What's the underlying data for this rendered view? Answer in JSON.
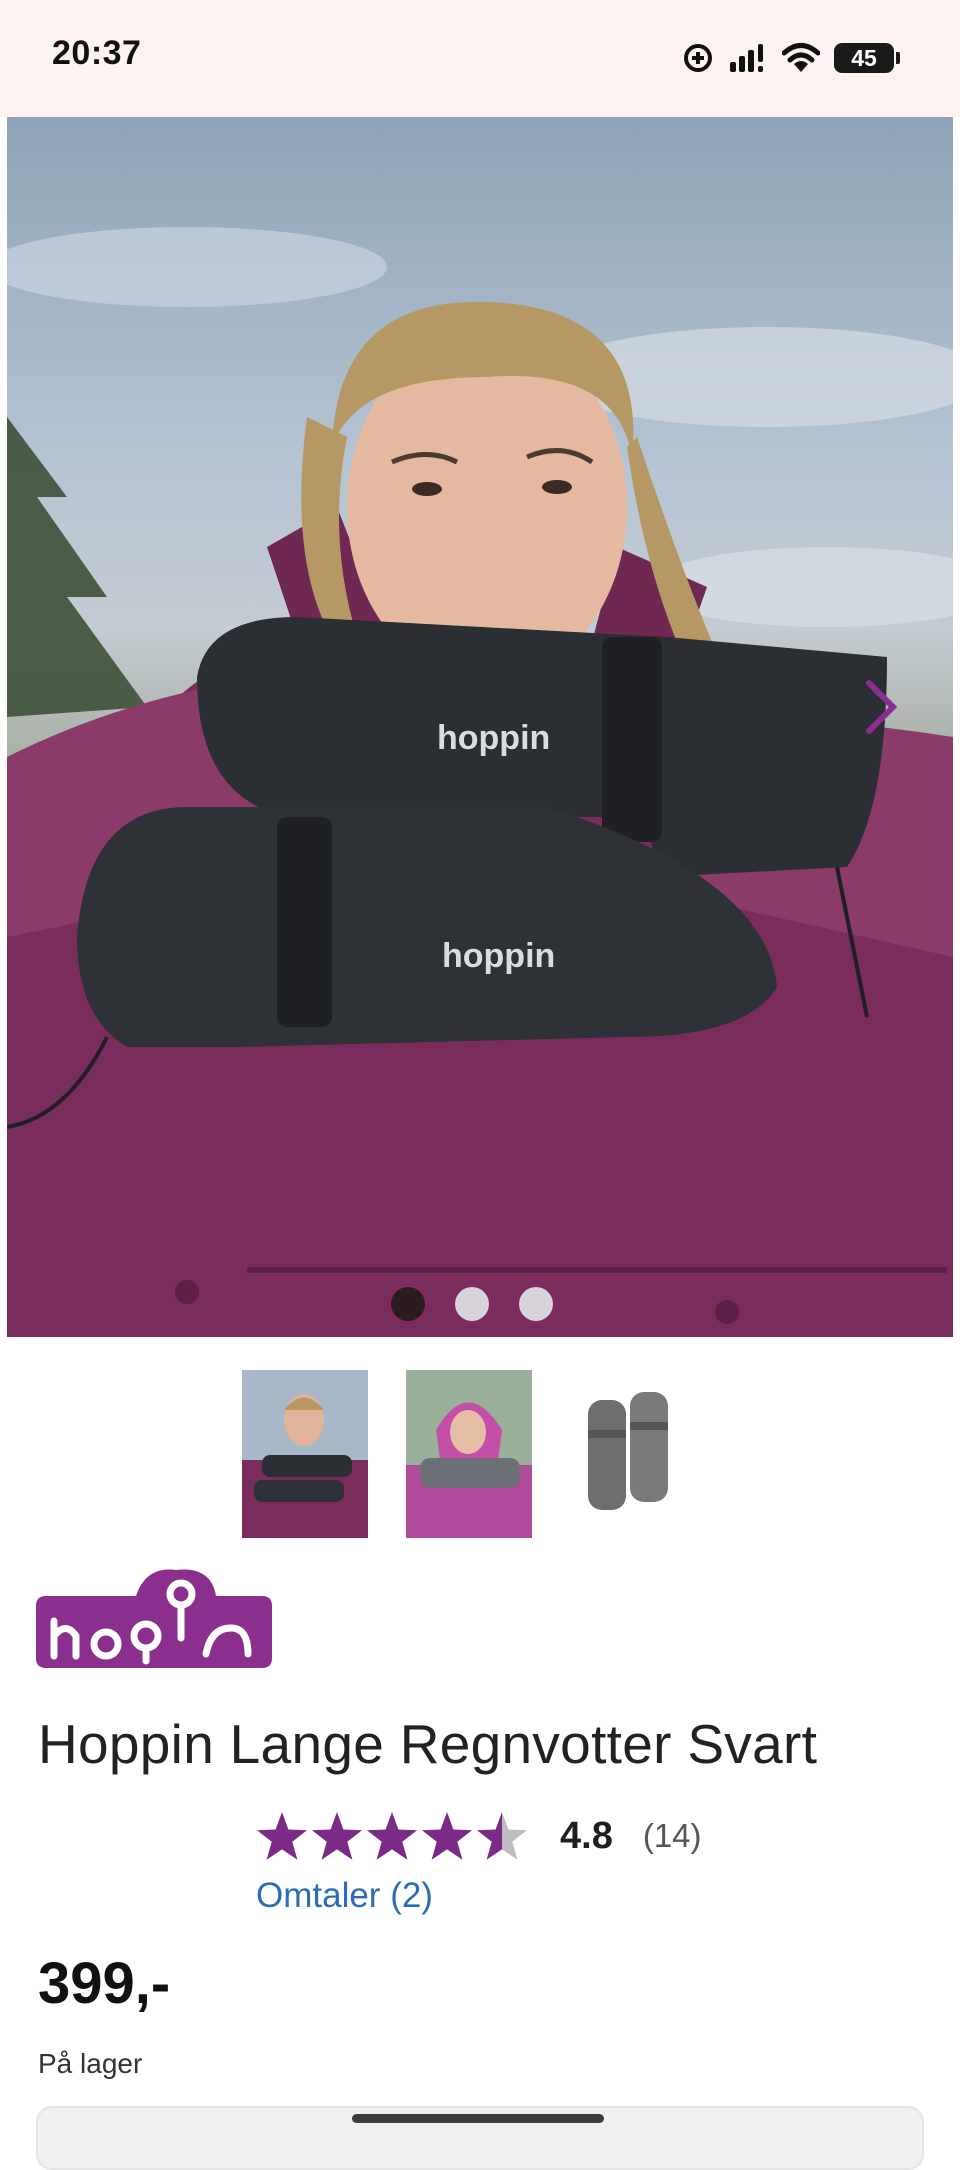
{
  "status_bar": {
    "time": "20:37",
    "battery": "45",
    "icons": [
      "data-saver-icon",
      "signal-icon",
      "wifi-icon",
      "battery-icon"
    ]
  },
  "gallery": {
    "main_image_alt": "product-photo",
    "slide_count": 3,
    "active_slide": 1,
    "thumbnails": [
      "thumbnail-woman-purple-jacket",
      "thumbnail-woman-pink-hood",
      "thumbnail-black-mittens"
    ],
    "next_icon": "chevron-right-icon"
  },
  "product": {
    "brand_text": "hoppin",
    "title": "Hoppin Lange Regnvotter Svart",
    "rating_value": "4.8",
    "rating_count": "(14)",
    "rating_fraction": 0.96,
    "reviews_link": "Omtaler (2)",
    "price": "399,-",
    "stock_status": "På lager"
  },
  "colors": {
    "brand_purple": "#8a2f8e",
    "link_blue": "#2a6fb6",
    "star_purple": "#7b2b86",
    "status_bar_bg": "#fdf3f1"
  }
}
